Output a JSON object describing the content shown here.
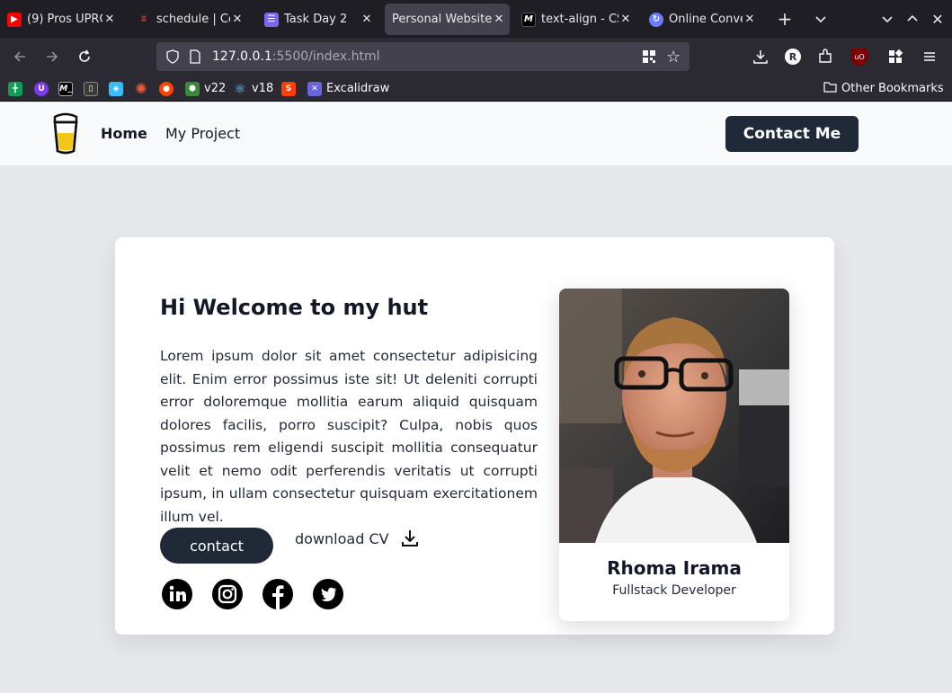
{
  "browser": {
    "tabs": [
      {
        "title": "(9) Pros UPRO",
        "favicon": "youtube-icon",
        "color": "#ff0000"
      },
      {
        "title": "schedule | Co",
        "favicon": "codewars-icon",
        "color": "#b1361e"
      },
      {
        "title": "Task Day 2",
        "favicon": "list-icon",
        "color": "#7b68ee"
      },
      {
        "title": "Personal Website",
        "favicon": "",
        "color": ""
      },
      {
        "title": "text-align - CS",
        "favicon": "mdn-icon",
        "color": "#000000"
      },
      {
        "title": "Online Conve",
        "favicon": "converter-icon",
        "color": "#6b7cff"
      }
    ],
    "url_host": "127.0.0.1",
    "url_path": ":5500/index.html",
    "bookmarks": [
      {
        "label": "",
        "icon": "sheets-icon",
        "color": "#0f9d58"
      },
      {
        "label": "",
        "icon": "extension-icon",
        "color": "#7c3aed"
      },
      {
        "label": "",
        "icon": "ml-icon",
        "color": "#000000"
      },
      {
        "label": "",
        "icon": "book-icon",
        "color": "#3a3a3a"
      },
      {
        "label": "",
        "icon": "file-icon",
        "color": "#38bdf8"
      },
      {
        "label": "",
        "icon": "burst-icon",
        "color": "#e85d3a"
      },
      {
        "label": "",
        "icon": "reddit-icon",
        "color": "#ff4500"
      },
      {
        "label": "v22",
        "icon": "node-icon",
        "color": "#3c873a"
      },
      {
        "label": "v18",
        "icon": "react-icon",
        "color": "#61dafb"
      },
      {
        "label": "",
        "icon": "svelte-icon",
        "color": "#ff3e00"
      },
      {
        "label": "Excalidraw",
        "icon": "excalidraw-icon",
        "color": "#6965db"
      }
    ],
    "other_bookmarks": "Other Bookmarks",
    "profile_initial": "R"
  },
  "site": {
    "nav": {
      "home": "Home",
      "project": "My Project",
      "contact": "Contact Me"
    },
    "hero": {
      "heading": "Hi Welcome to my hut",
      "bio": "Lorem ipsum dolor sit amet consectetur adipisicing elit. Enim error possimus iste sit! Ut deleniti corrupti error doloremque mollitia earum aliquid quisquam dolores facilis, porro suscipit? Culpa, nobis quos possimus rem eligendi suscipit mollitia consequatur velit et nemo odit perferendis veritatis ut corrupti ipsum, in ullam consectetur quisquam exercitationem illum vel.",
      "contact_button": "contact",
      "download_label": "download CV"
    },
    "profile": {
      "name": "Rhoma Irama",
      "role": "Fullstack Developer"
    },
    "socials": [
      "linkedin-icon",
      "instagram-icon",
      "facebook-icon",
      "twitter-icon"
    ]
  }
}
